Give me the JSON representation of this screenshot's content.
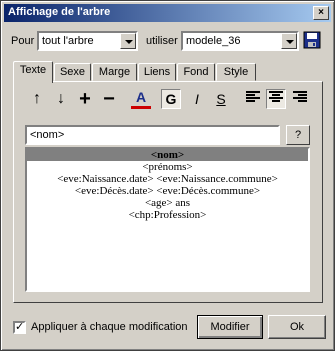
{
  "window": {
    "title": "Affichage de l'arbre",
    "close_glyph": "×"
  },
  "top": {
    "pour_label": "Pour",
    "pour_value": "tout l'arbre",
    "utiliser_label": "utiliser",
    "utiliser_value": "modele_36",
    "save_icon": "floppy-disk-icon"
  },
  "tabs": [
    {
      "label": "Texte",
      "active": true
    },
    {
      "label": "Sexe",
      "active": false
    },
    {
      "label": "Marge",
      "active": false
    },
    {
      "label": "Liens",
      "active": false
    },
    {
      "label": "Fond",
      "active": false
    },
    {
      "label": "Style",
      "active": false
    }
  ],
  "toolbar": {
    "up": "↑",
    "down": "↓",
    "plus": "+",
    "minus": "−",
    "color": "A",
    "bold": "G",
    "italic": "I",
    "strike": "S",
    "color_accent": "#cc0000"
  },
  "template_input": "<nom>",
  "help_label": "?",
  "preview_lines": [
    "<nom>",
    "<prénoms>",
    "<eve:Naissance.date> <eve:Naissance.commune>",
    "<eve:Décès.date> <eve:Décès.commune>",
    "<age> ans",
    "<chp:Profession>"
  ],
  "bottom": {
    "checkbox_label": "Appliquer à chaque modification",
    "checkbox_mark": "✓",
    "modifier_label": "Modifier",
    "ok_label": "Ok"
  }
}
